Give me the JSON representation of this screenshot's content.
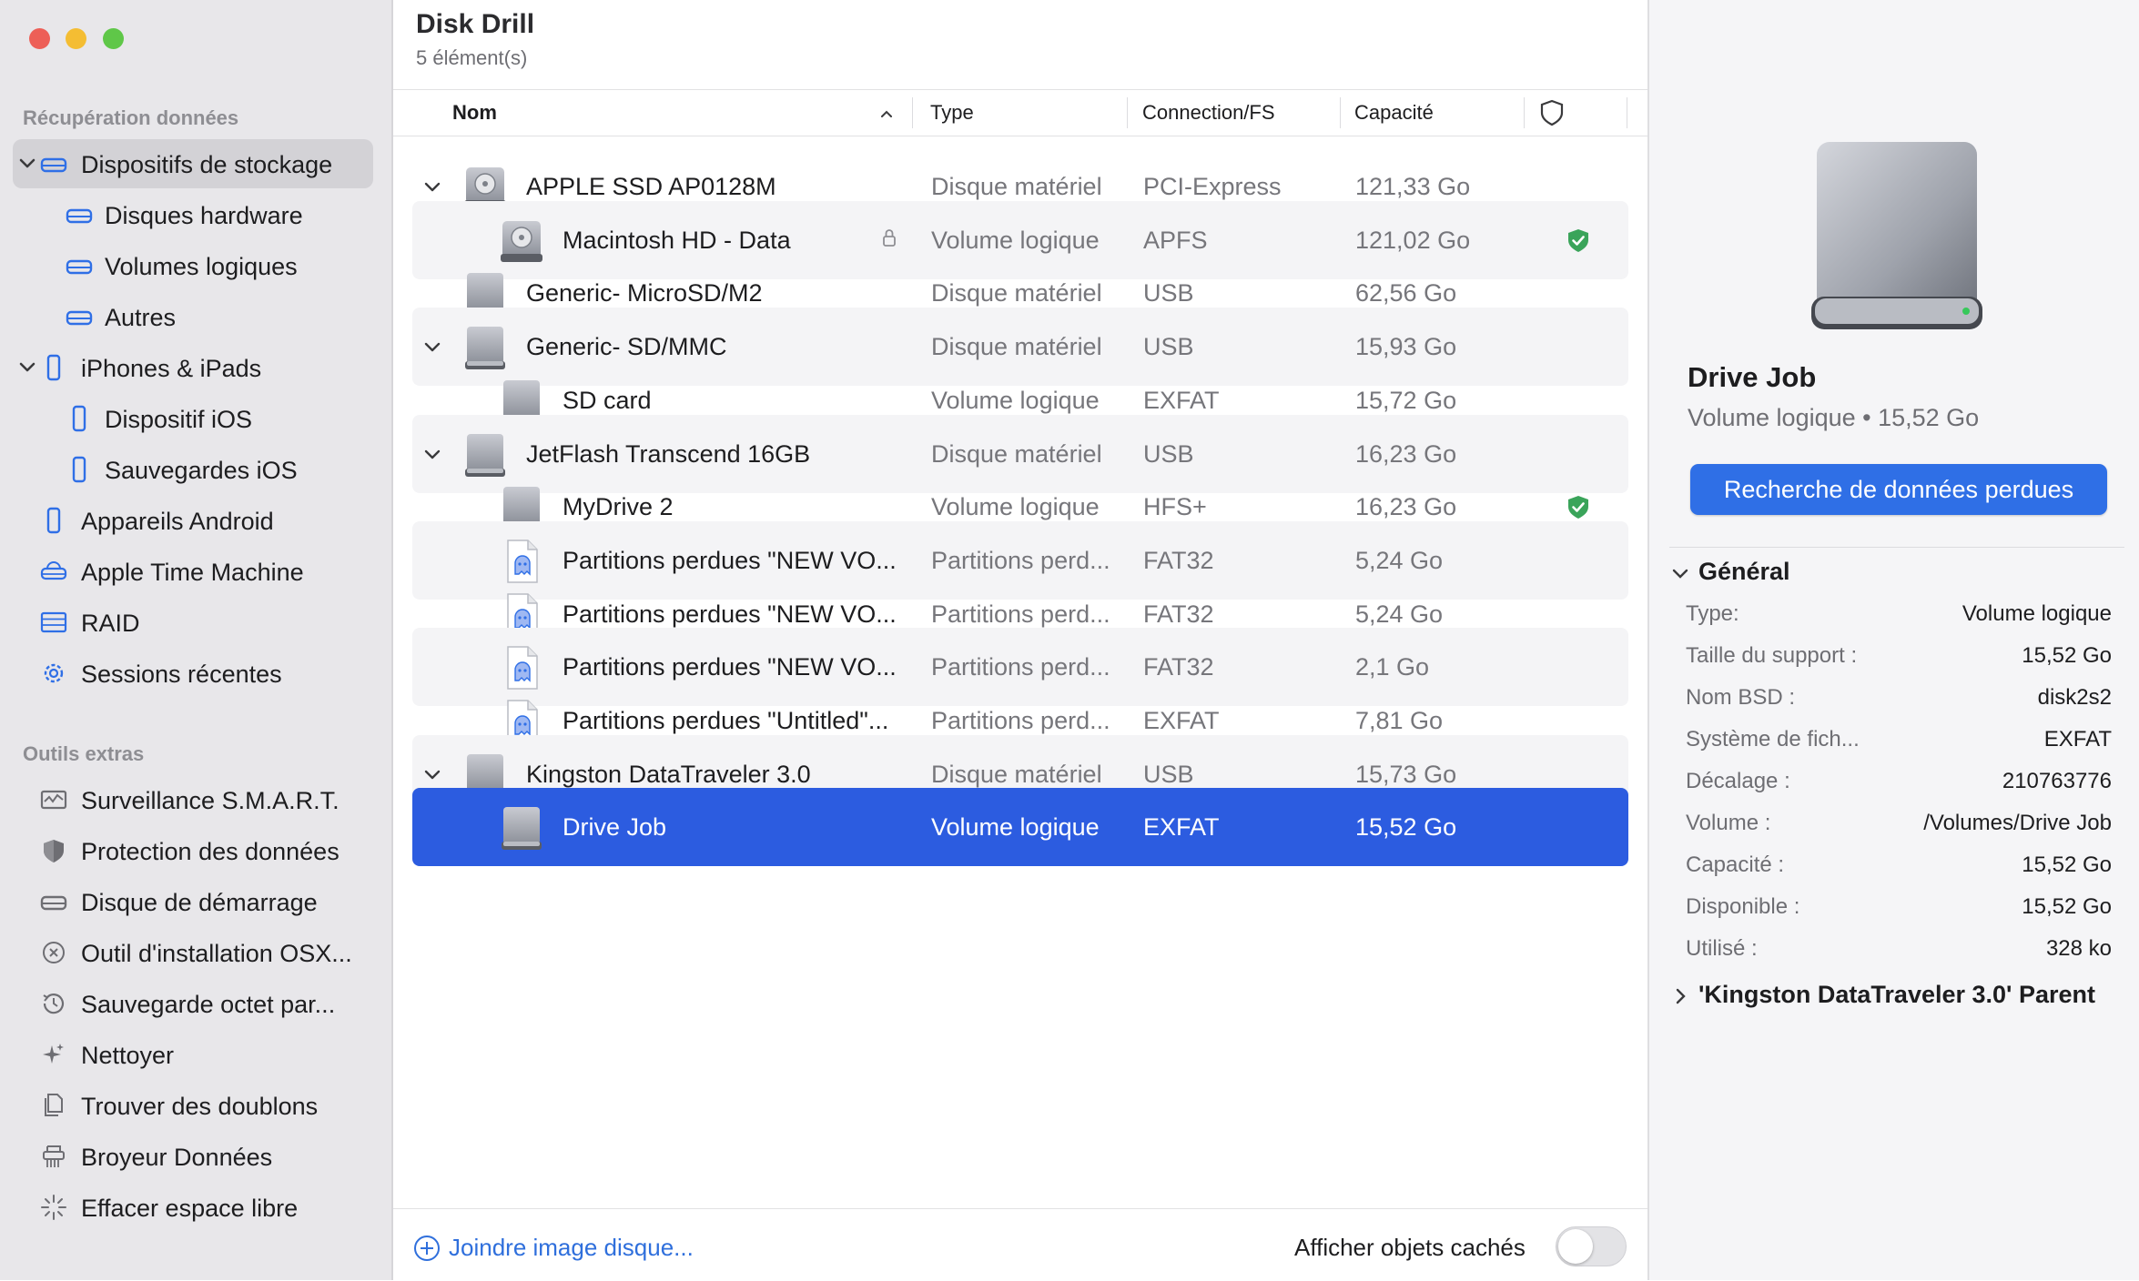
{
  "window": {
    "title": "Disk Drill",
    "subtitle": "5 élément(s)"
  },
  "sidebar": {
    "section1": "Récupération données",
    "section2": "Outils extras",
    "items": [
      {
        "label": "Dispositifs de stockage",
        "icon": "drive-icon"
      },
      {
        "label": "Disques hardware",
        "icon": "drive-icon"
      },
      {
        "label": "Volumes logiques",
        "icon": "drive-icon"
      },
      {
        "label": "Autres",
        "icon": "drive-icon"
      },
      {
        "label": "iPhones & iPads",
        "icon": "iphone-icon"
      },
      {
        "label": "Dispositif iOS",
        "icon": "iphone-icon"
      },
      {
        "label": "Sauvegardes iOS",
        "icon": "iphone-icon"
      },
      {
        "label": "Appareils Android",
        "icon": "android-phone-icon"
      },
      {
        "label": "Apple Time Machine",
        "icon": "time-machine-icon"
      },
      {
        "label": "RAID",
        "icon": "raid-icon"
      },
      {
        "label": "Sessions récentes",
        "icon": "gear-icon"
      }
    ],
    "tools": [
      {
        "label": "Surveillance S.M.A.R.T.",
        "icon": "smart-monitor-icon"
      },
      {
        "label": "Protection des données",
        "icon": "shield-icon"
      },
      {
        "label": "Disque de démarrage",
        "icon": "drive-icon"
      },
      {
        "label": "Outil d'installation OSX...",
        "icon": "x-circle-icon"
      },
      {
        "label": "Sauvegarde octet par...",
        "icon": "history-icon"
      },
      {
        "label": "Nettoyer",
        "icon": "sparkle-icon"
      },
      {
        "label": "Trouver des doublons",
        "icon": "duplicate-icon"
      },
      {
        "label": "Broyeur Données",
        "icon": "shredder-icon"
      },
      {
        "label": "Effacer espace libre",
        "icon": "burst-icon"
      }
    ]
  },
  "table": {
    "columns": {
      "name": "Nom",
      "type": "Type",
      "conn": "Connection/FS",
      "cap": "Capacité"
    },
    "rows": [
      {
        "name": "APPLE SSD AP0128M",
        "type": "Disque matériel",
        "conn": "PCI-Express",
        "cap": "121,33 Go"
      },
      {
        "name": "Macintosh HD - Data",
        "type": "Volume logique",
        "conn": "APFS",
        "cap": "121,02 Go"
      },
      {
        "name": "Generic- MicroSD/M2",
        "type": "Disque matériel",
        "conn": "USB",
        "cap": "62,56 Go"
      },
      {
        "name": "Generic- SD/MMC",
        "type": "Disque matériel",
        "conn": "USB",
        "cap": "15,93 Go"
      },
      {
        "name": "SD card",
        "type": "Volume logique",
        "conn": "EXFAT",
        "cap": "15,72 Go"
      },
      {
        "name": "JetFlash Transcend 16GB",
        "type": "Disque matériel",
        "conn": "USB",
        "cap": "16,23 Go"
      },
      {
        "name": "MyDrive 2",
        "type": "Volume logique",
        "conn": "HFS+",
        "cap": "16,23 Go"
      },
      {
        "name": "Partitions perdues \"NEW VO...",
        "type": "Partitions perd...",
        "conn": "FAT32",
        "cap": "5,24 Go"
      },
      {
        "name": "Partitions perdues \"NEW VO...",
        "type": "Partitions perd...",
        "conn": "FAT32",
        "cap": "5,24 Go"
      },
      {
        "name": "Partitions perdues \"NEW VO...",
        "type": "Partitions perd...",
        "conn": "FAT32",
        "cap": "2,1 Go"
      },
      {
        "name": "Partitions perdues \"Untitled\"...",
        "type": "Partitions perd...",
        "conn": "EXFAT",
        "cap": "7,81 Go"
      },
      {
        "name": "Kingston DataTraveler 3.0",
        "type": "Disque matériel",
        "conn": "USB",
        "cap": "15,73 Go"
      },
      {
        "name": "Drive Job",
        "type": "Volume logique",
        "conn": "EXFAT",
        "cap": "15,52 Go"
      }
    ]
  },
  "footer": {
    "attach": "Joindre image disque...",
    "show_hidden": "Afficher objets cachés"
  },
  "inspector": {
    "name": "Drive Job",
    "subtitle": "Volume logique • 15,52 Go",
    "scan_button": "Recherche de données perdues",
    "general_title": "Général",
    "general": [
      {
        "k": "Type:",
        "v": "Volume logique"
      },
      {
        "k": "Taille du support :",
        "v": "15,52 Go"
      },
      {
        "k": "Nom BSD :",
        "v": "disk2s2"
      },
      {
        "k": "Système de fich...",
        "v": "EXFAT"
      },
      {
        "k": "Décalage :",
        "v": "210763776"
      },
      {
        "k": "Volume :",
        "v": "/Volumes/Drive Job"
      },
      {
        "k": "Capacité :",
        "v": "15,52 Go"
      },
      {
        "k": "Disponible :",
        "v": "15,52 Go"
      },
      {
        "k": "Utilisé :",
        "v": "328 ko"
      }
    ],
    "parent": "'Kingston DataTraveler 3.0' Parent"
  },
  "colors": {
    "accent": "#2f6fe6",
    "selection": "#2c5ce0",
    "protected": "#3aa45a"
  }
}
